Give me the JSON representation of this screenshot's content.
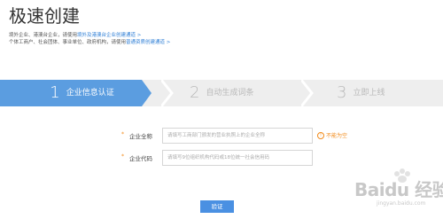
{
  "page": {
    "title": "极速创建"
  },
  "notices": {
    "line1_prefix": "境外企业、港澳台企业，请使用",
    "line1_link": "境外及港澳台企业创建通道",
    "line1_arrow": ">",
    "line2_prefix": "个体工商户、社会团体、事业单位、政府机构，请使用",
    "line2_link": "普通资质创建通道",
    "line2_arrow": ">"
  },
  "steps": [
    {
      "num": "1",
      "label": "企业信息认证",
      "active": true
    },
    {
      "num": "2",
      "label": "自动生成词条",
      "active": false
    },
    {
      "num": "3",
      "label": "立即上线",
      "active": false
    }
  ],
  "form": {
    "required_mark": "*",
    "company_name": {
      "label": "企业全称",
      "placeholder": "请填写工商部门颁发的营业执照上的企业全称",
      "hint": "不能为空",
      "hint_icon": "warning-circle-icon"
    },
    "company_code": {
      "label": "企业代码",
      "placeholder": "请填写9位组织机构代码或18位统一社会信用码"
    }
  },
  "actions": {
    "verify_label": "验证"
  },
  "colors": {
    "accent": "#5b9de0",
    "warning": "#f28b1b",
    "button": "#4a90e2"
  },
  "watermark": {
    "brand": "Baidu 经验",
    "sub": "jingyan.baidu.com"
  }
}
